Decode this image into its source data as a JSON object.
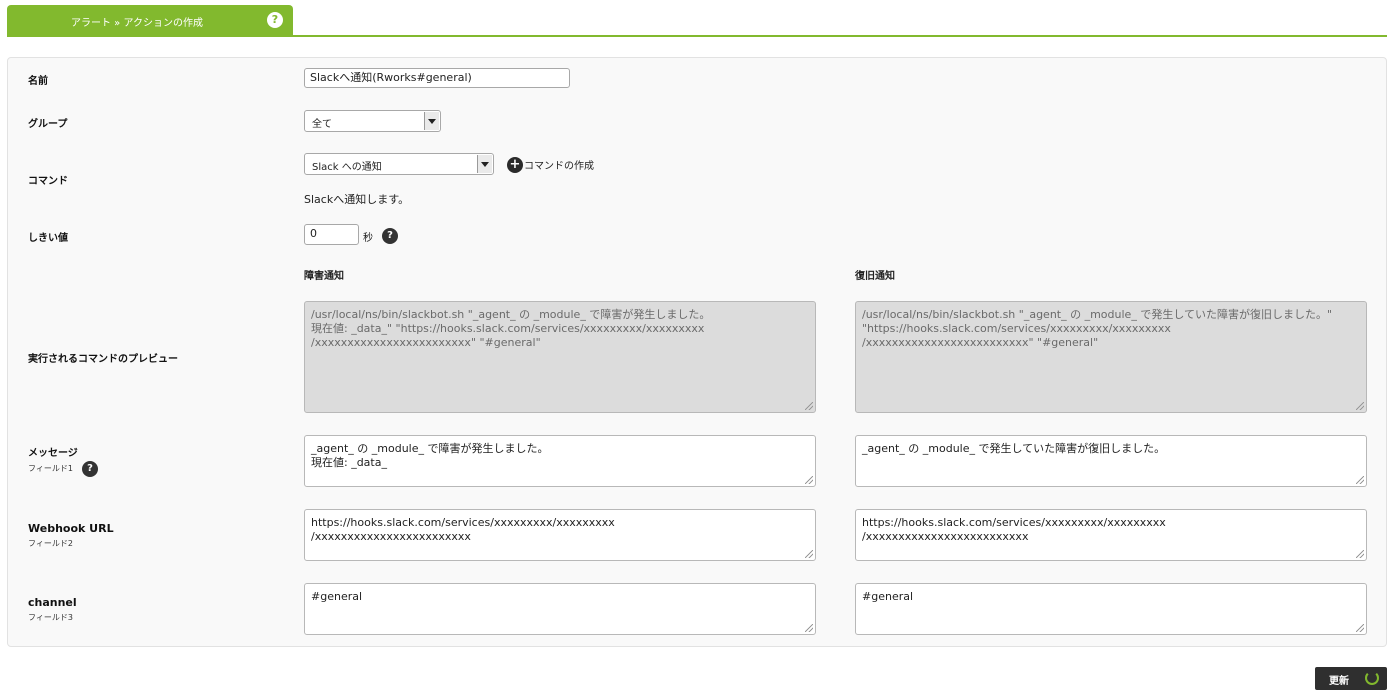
{
  "header": {
    "breadcrumb": "アラート » アクションの作成",
    "help_glyph": "?"
  },
  "form": {
    "name": {
      "label": "名前",
      "value": "Slackへ通知(Rworks#general)"
    },
    "group": {
      "label": "グループ",
      "value": "全て"
    },
    "command": {
      "label": "コマンド",
      "value": "Slack への通知",
      "create_label": "コマンドの作成",
      "plus_glyph": "+",
      "description": "Slackへ通知します。"
    },
    "threshold": {
      "label": "しきい値",
      "value": "0",
      "unit": "秒",
      "help_glyph": "?"
    },
    "columns": {
      "failure": "障害通知",
      "recovery": "復旧通知"
    },
    "preview": {
      "label": "実行されるコマンドのプレビュー",
      "failure_lines": [
        "/usr/local/ns/bin/slackbot.sh \"_agent_ の _module_ で障害が発生しました。",
        "現在値: _data_\" \"https://hooks.slack.com/services/xxxxxxxxx/xxxxxxxxx",
        "/xxxxxxxxxxxxxxxxxxxxxxxx\" \"#general\""
      ],
      "recovery_lines": [
        "/usr/local/ns/bin/slackbot.sh \"_agent_ の _module_ で発生していた障害が復旧しました。\"",
        "\"https://hooks.slack.com/services/xxxxxxxxx/xxxxxxxxx",
        "/xxxxxxxxxxxxxxxxxxxxxxxxx\" \"#general\""
      ]
    },
    "message": {
      "label": "メッセージ",
      "sub": "フィールド1",
      "help_glyph": "?",
      "failure_lines": [
        "_agent_ の _module_ で障害が発生しました。",
        "現在値: _data_"
      ],
      "recovery_lines": [
        "_agent_ の _module_ で発生していた障害が復旧しました。"
      ]
    },
    "webhook": {
      "label": "Webhook URL",
      "sub": "フィールド2",
      "failure_lines": [
        "https://hooks.slack.com/services/xxxxxxxxx/xxxxxxxxx",
        "/xxxxxxxxxxxxxxxxxxxxxxxx"
      ],
      "recovery_lines": [
        "https://hooks.slack.com/services/xxxxxxxxx/xxxxxxxxx",
        "/xxxxxxxxxxxxxxxxxxxxxxxxx"
      ]
    },
    "channel": {
      "label": "channel",
      "sub": "フィールド3",
      "failure_lines": [
        "#general"
      ],
      "recovery_lines": [
        "#general"
      ]
    }
  },
  "actions": {
    "update_label": "更新"
  },
  "colors": {
    "accent": "#82b92e",
    "button": "#2f2f2f"
  }
}
